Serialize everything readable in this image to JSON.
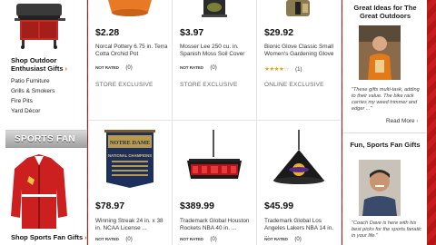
{
  "left": {
    "outdoor_title": "Shop Outdoor Enthusiast Gifts",
    "links": [
      "Patio Furniture",
      "Grills & Smokers",
      "Fire Pits",
      "Yard Décor"
    ],
    "sports_banner": "SPORTS FAN",
    "sports_title": "Shop Sports Fan Gifts"
  },
  "rating_badge": "NOT RATED",
  "products": [
    {
      "price": "$2.28",
      "desc": "Norcal Pottery 6.75 in. Terra Cotta Orchid Pot",
      "count": "(0)",
      "tag": "STORE EXCLUSIVE"
    },
    {
      "price": "$3.97",
      "desc": "Mosser Lee 250 cu. in. Spanish Moss Soil Cover",
      "count": "(0)",
      "tag": "STORE EXCLUSIVE"
    },
    {
      "price": "$29.92",
      "desc": "Bionic Glove Classic Small Women's Gardening Glove",
      "count": "(1)",
      "tag": "ONLINE EXCLUSIVE",
      "stars": "★★★★☆",
      "rating": 4
    },
    {
      "price": "$78.97",
      "desc": "Winning Streak 24 in. x 38 in. NCAA License ...",
      "count": "(0)",
      "tag": ""
    },
    {
      "price": "$389.99",
      "desc": "Trademark Global Houston Rockets NBA 40 in. ...",
      "count": "(0)",
      "tag": ""
    },
    {
      "price": "$45.99",
      "desc": "Trademark Global Los Angeles Lakers NBA 14 in. ...",
      "count": "(0)",
      "tag": ""
    }
  ],
  "banner_text": {
    "line1": "NOTRE DAME",
    "line2": "NATIONAL CHAMPIONS"
  },
  "right": {
    "title1": "Great Ideas for The Great Outdoors",
    "quote1": "\"These gifts multi-task, adding to their value. The bike rack carries my weed trimmer and edger ...\"",
    "read_more": "Read More",
    "title2": "Fun, Sports Fan Gifts",
    "quote2": "\"Coach Dave is here with his best picks for the sports fanatic in your life.\""
  },
  "colors": {
    "accent": "#d9531e",
    "background_red": "#c41a1a"
  }
}
